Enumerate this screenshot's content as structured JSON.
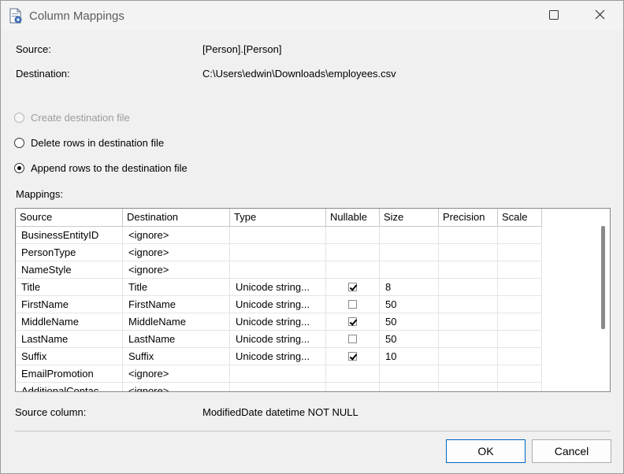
{
  "window": {
    "title": "Column Mappings"
  },
  "info": {
    "source_label": "Source:",
    "source_value": "[Person].[Person]",
    "destination_label": "Destination:",
    "destination_value": "C:\\Users\\edwin\\Downloads\\employees.csv"
  },
  "options": {
    "create": "Create destination file",
    "delete": "Delete rows in destination file",
    "append": "Append rows to the destination file",
    "selected": "append"
  },
  "mappings": {
    "label": "Mappings:",
    "columns": [
      "Source",
      "Destination",
      "Type",
      "Nullable",
      "Size",
      "Precision",
      "Scale"
    ],
    "rows": [
      {
        "source": "BusinessEntityID",
        "destination": "<ignore>",
        "type": "",
        "nullable": null,
        "size": ""
      },
      {
        "source": "PersonType",
        "destination": "<ignore>",
        "type": "",
        "nullable": null,
        "size": ""
      },
      {
        "source": "NameStyle",
        "destination": "<ignore>",
        "type": "",
        "nullable": null,
        "size": ""
      },
      {
        "source": "Title",
        "destination": "Title",
        "type": "Unicode string...",
        "nullable": true,
        "size": "8"
      },
      {
        "source": "FirstName",
        "destination": "FirstName",
        "type": "Unicode string...",
        "nullable": false,
        "size": "50"
      },
      {
        "source": "MiddleName",
        "destination": "MiddleName",
        "type": "Unicode string...",
        "nullable": true,
        "size": "50"
      },
      {
        "source": "LastName",
        "destination": "LastName",
        "type": "Unicode string...",
        "nullable": false,
        "size": "50"
      },
      {
        "source": "Suffix",
        "destination": "Suffix",
        "type": "Unicode string...",
        "nullable": true,
        "size": "10"
      },
      {
        "source": "EmailPromotion",
        "destination": "<ignore>",
        "type": "",
        "nullable": null,
        "size": ""
      },
      {
        "source": "AdditionalContac",
        "destination": "<ignore>",
        "type": "",
        "nullable": null,
        "size": ""
      }
    ]
  },
  "source_column": {
    "label": "Source column:",
    "value": "ModifiedDate datetime NOT NULL"
  },
  "buttons": {
    "ok": "OK",
    "cancel": "Cancel"
  },
  "icons": {
    "app": "document-gear-icon",
    "maximize": "maximize-icon",
    "close": "close-icon"
  }
}
